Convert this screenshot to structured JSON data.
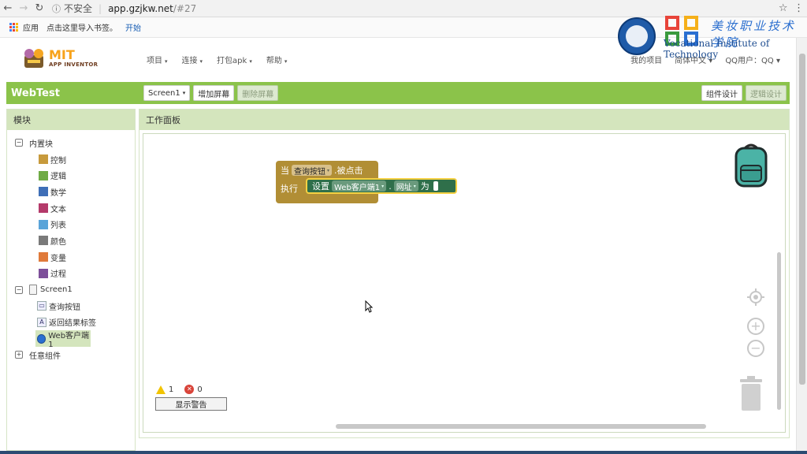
{
  "browser": {
    "insecure_label": "不安全",
    "url_host": "app.gzjkw.net",
    "url_path": "/#27",
    "bookmarks": {
      "apps": "应用",
      "import_hint": "点击这里导入书签。",
      "start_link": "开始"
    }
  },
  "watermark": {
    "school_name": "美妆职业技术学院",
    "english_name": "Vocational Institute of Technology"
  },
  "header": {
    "logo_text": "MIT",
    "logo_subtext": "APP INVENTOR",
    "menu": [
      "项目",
      "连接",
      "打包apk",
      "帮助"
    ],
    "right_menu": [
      "我的项目",
      "简体中文",
      "QQ用户：QQ"
    ]
  },
  "project_bar": {
    "project_name": "WebTest",
    "screen_select": "Screen1",
    "add_screen": "增加屏幕",
    "remove_screen": "删除屏幕",
    "designer": "组件设计",
    "blocks": "逻辑设计"
  },
  "blocks_panel": {
    "title": "模块",
    "builtin": {
      "label": "内置块",
      "items": [
        {
          "label": "控制",
          "color": "#c79a3c"
        },
        {
          "label": "逻辑",
          "color": "#6fab45"
        },
        {
          "label": "数学",
          "color": "#3f6fb7"
        },
        {
          "label": "文本",
          "color": "#b43a6a"
        },
        {
          "label": "列表",
          "color": "#5aa4d9"
        },
        {
          "label": "颜色",
          "color": "#7a7a7a"
        },
        {
          "label": "变量",
          "color": "#e07a3a"
        },
        {
          "label": "过程",
          "color": "#7d4f9a"
        }
      ]
    },
    "screen": {
      "label": "Screen1",
      "components": [
        {
          "label": "查询按钮",
          "icon": "button-icon"
        },
        {
          "label": "返回结果标签",
          "icon": "label-icon"
        },
        {
          "label": "Web客户端1",
          "icon": "web-icon"
        }
      ]
    },
    "any_component": "任意组件"
  },
  "workspace": {
    "title": "工作面板",
    "event_block": {
      "when": "当",
      "component": "查询按钮",
      "event": ".被点击",
      "do": "执行"
    },
    "set_block": {
      "set": "设置",
      "component": "Web客户端1",
      "dot": ".",
      "property": "网址",
      "to": "为"
    },
    "warnings_count": "1",
    "errors_count": "0",
    "show_warnings": "显示警告"
  }
}
